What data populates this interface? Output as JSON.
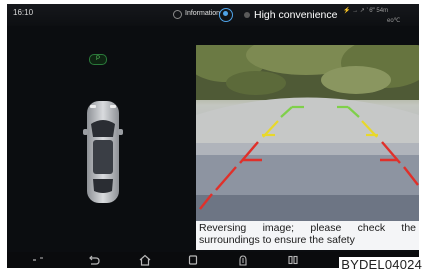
{
  "status_bar": {
    "clock": "16:10",
    "info_label": "Information",
    "mode_label": "High convenience",
    "indicators": "⚡ → ↗ ’ 6‴ 54m",
    "indicators_secondary": "eo℃"
  },
  "left_panel": {
    "park_badge": "P"
  },
  "camera": {
    "caption": "Reversing image; please check the surroundings to ensure the safety"
  },
  "nav_bar": {
    "items": [
      "handle",
      "back",
      "home",
      "recents",
      "app",
      "split"
    ]
  },
  "watermark": "BYDEL04024",
  "colors": {
    "screen_bg": "#0b0d10",
    "guide_red": "#e0302a",
    "guide_yellow": "#e8d82a",
    "guide_green": "#7fd04a",
    "accent_blue": "#4fa3e8"
  }
}
